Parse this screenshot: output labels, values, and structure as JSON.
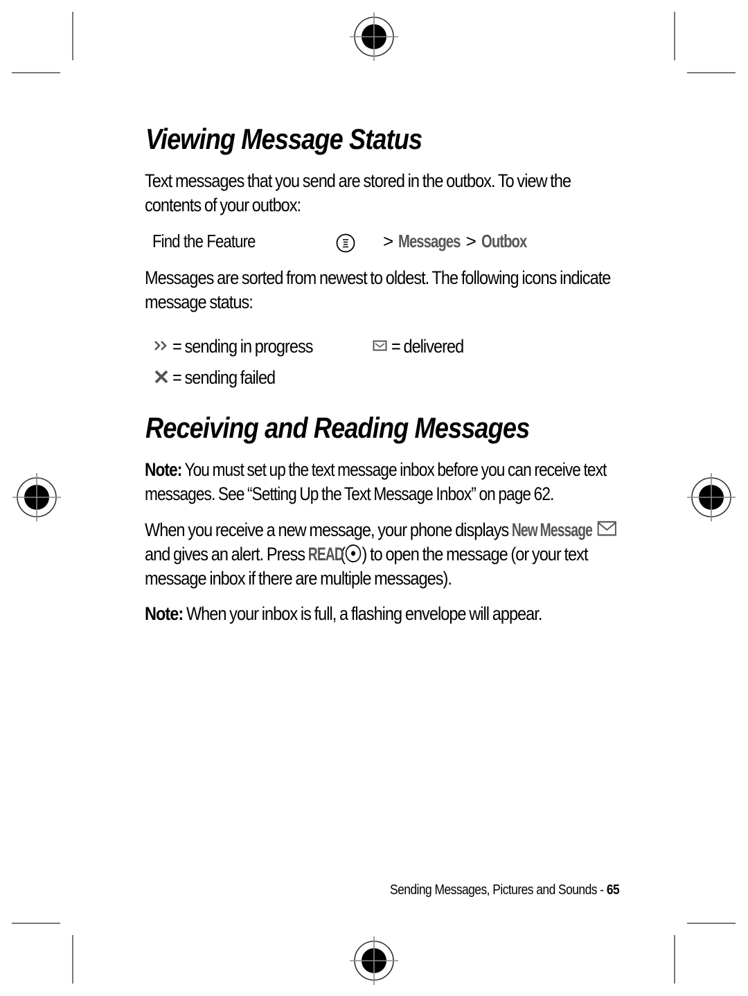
{
  "section1": {
    "title": "Viewing Message Status",
    "intro": "Text messages that you send are stored in the outbox. To view the contents of your outbox:",
    "intro_line1": "Text messages that you send are stored in the outbox. To view the",
    "intro_line2": "contents of your outbox:",
    "find_feature": {
      "label": "Find the Feature",
      "menu_key_icon": "menu-key-icon",
      "separator": ">",
      "path": [
        "Messages",
        "Outbox"
      ]
    },
    "sorted_line1": "Messages are sorted from newest to oldest. The following icons indicate",
    "sorted_line2": "message status:",
    "status_icons": [
      {
        "icon": "double-chevron-icon",
        "text": "= sending in progress"
      },
      {
        "icon": "envelope-icon",
        "text": "= delivered"
      },
      {
        "icon": "x-mark-icon",
        "text": "= sending failed"
      }
    ]
  },
  "section2": {
    "title": "Receiving and Reading Messages",
    "note1": {
      "label": "Note:",
      "line1": " You must set up the text message inbox before you can receive text",
      "line2": "messages. See “Setting Up the Text Message Inbox” on page 62."
    },
    "para": {
      "line1_pre": "When you receive a new message, your phone displays ",
      "new_message": "New Message",
      "line2_pre": "and gives an alert. Press ",
      "read_key": "READ",
      "open_paren": " (",
      "line2_post": ") to open the message (or your text",
      "line3": "message inbox if there are multiple messages)."
    },
    "note2": {
      "label": "Note:",
      "text": " When your inbox is full, a flashing envelope will appear."
    }
  },
  "footer": {
    "chapter": "Sending Messages, Pictures and Sounds - ",
    "page_number": "65"
  },
  "colors": {
    "ui_text": "#555555",
    "crop_marks": "#777777"
  }
}
